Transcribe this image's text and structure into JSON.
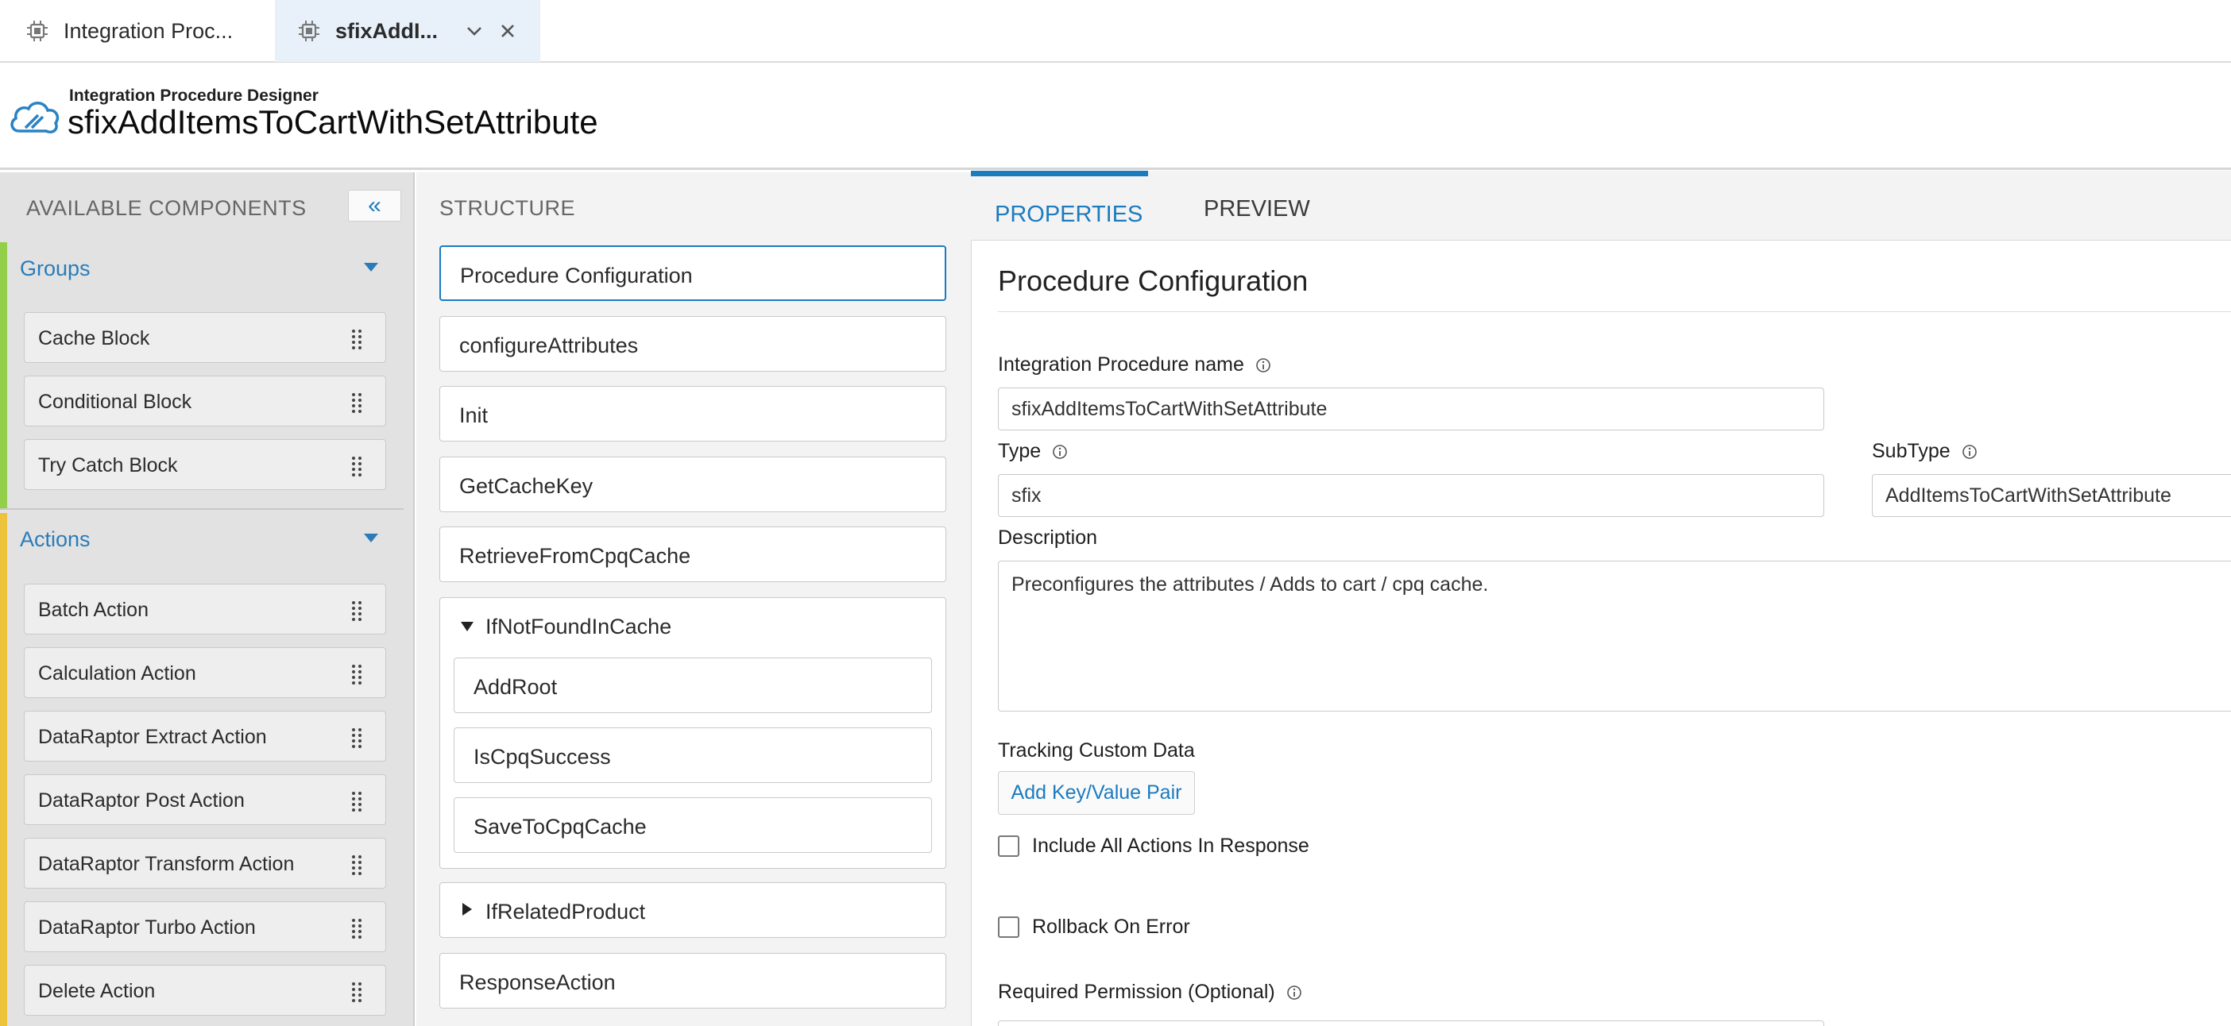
{
  "tabs": [
    {
      "title": "Integration Proc...",
      "icon": "chip-icon"
    },
    {
      "title": "sfixAddI...",
      "icon": "chip-icon",
      "active": true
    }
  ],
  "header": {
    "subtitle": "Integration Procedure Designer",
    "title": "sfixAddItemsToCartWithSetAttribute",
    "logo": "cloud-logo-icon"
  },
  "left_panel": {
    "title": "AVAILABLE COMPONENTS",
    "collapse_glyph": "«",
    "groups": {
      "title": "Groups",
      "color": "#93cf48",
      "items": [
        "Cache Block",
        "Conditional Block",
        "Try Catch Block"
      ]
    },
    "actions": {
      "title": "Actions",
      "color": "#ecc33a",
      "items": [
        "Batch Action",
        "Calculation Action",
        "DataRaptor Extract Action",
        "DataRaptor Post Action",
        "DataRaptor Transform Action",
        "DataRaptor Turbo Action",
        "Delete Action"
      ]
    }
  },
  "structure": {
    "title": "STRUCTURE",
    "items": [
      "Procedure Configuration",
      "configureAttributes",
      "Init",
      "GetCacheKey",
      "RetrieveFromCpqCache"
    ],
    "group_expanded": {
      "label": "IfNotFoundInCache",
      "children": [
        "AddRoot",
        "IsCpqSuccess",
        "SaveToCpqCache"
      ]
    },
    "group_collapsed": {
      "label": "IfRelatedProduct"
    },
    "last_item": "ResponseAction"
  },
  "properties": {
    "tabs": [
      "PROPERTIES",
      "PREVIEW"
    ],
    "active_tab": "PROPERTIES",
    "accent": "#1b7bbf",
    "title": "Procedure Configuration",
    "name_label": "Integration Procedure name",
    "name_value": "sfixAddItemsToCartWithSetAttribute",
    "type_label": "Type",
    "type_value": "sfix",
    "subtype_label": "SubType",
    "subtype_value": "AddItemsToCartWithSetAttribute",
    "description_label": "Description",
    "description_value": "Preconfigures the attributes  / Adds to cart / cpq cache.",
    "tracking_label": "Tracking Custom Data",
    "kv_button": "Add Key/Value Pair",
    "include_label": "Include All Actions In Response",
    "rollback_label": "Rollback On Error",
    "permission_label": "Required Permission (Optional)"
  }
}
